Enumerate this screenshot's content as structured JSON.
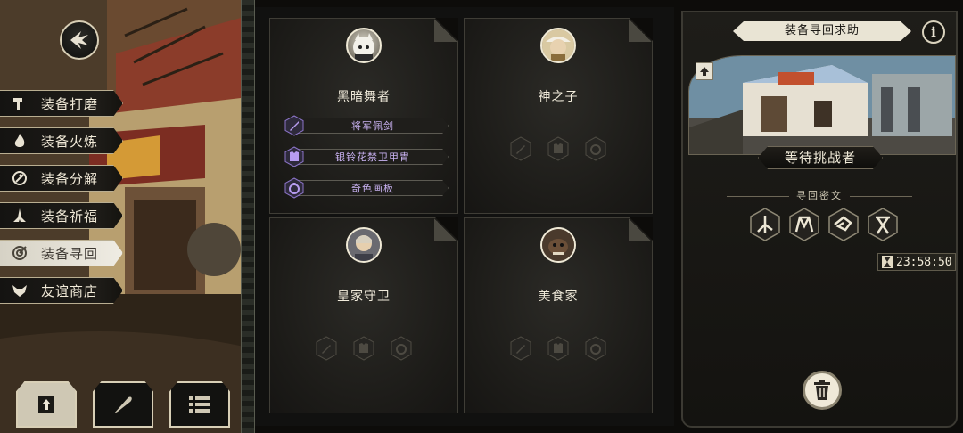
{
  "menu": {
    "items": [
      {
        "label": "装备打磨",
        "icon": "hammer-icon",
        "active": false
      },
      {
        "label": "装备火炼",
        "icon": "flame-icon",
        "active": false
      },
      {
        "label": "装备分解",
        "icon": "disassemble-icon",
        "active": false
      },
      {
        "label": "装备祈福",
        "icon": "pray-hands-icon",
        "active": false
      },
      {
        "label": "装备寻回",
        "icon": "target-icon",
        "active": true
      },
      {
        "label": "友谊商店",
        "icon": "fox-icon",
        "active": false
      }
    ]
  },
  "bottom_buttons": [
    {
      "icon": "upload-icon",
      "active": true
    },
    {
      "icon": "feather-icon",
      "active": false
    },
    {
      "icon": "list-icon",
      "active": false
    }
  ],
  "cards": [
    {
      "name": "黑暗舞者",
      "portrait": "dark-dancer-portrait",
      "equipment": [
        {
          "label": "将军佩剑",
          "icon": "sword-icon"
        },
        {
          "label": "银铃花禁卫甲胄",
          "icon": "armor-icon"
        },
        {
          "label": "奇色画板",
          "icon": "ring-icon"
        }
      ]
    },
    {
      "name": "神之子",
      "portrait": "god-child-portrait",
      "equipment": []
    },
    {
      "name": "皇家守卫",
      "portrait": "royal-guard-portrait",
      "equipment": []
    },
    {
      "name": "美食家",
      "portrait": "gourmet-portrait",
      "equipment": []
    }
  ],
  "help_panel": {
    "title": "装备寻回求助",
    "info_label": "i",
    "status": "等待挑战者",
    "rune_label": "寻回密文",
    "runes": [
      "rune-1-icon",
      "rune-2-icon",
      "rune-3-icon",
      "rune-4-icon"
    ],
    "timer": "23:58:50"
  },
  "colors": {
    "equip_text": "#c9b2f2",
    "panel_bg": "#1e1d19",
    "accent_light": "#e9e4d4"
  }
}
